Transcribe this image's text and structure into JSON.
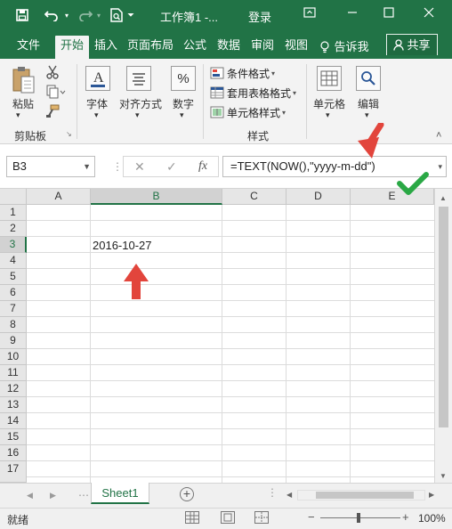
{
  "window": {
    "title": "工作簿1  -...",
    "login": "登录"
  },
  "tabs": [
    {
      "label": "文件"
    },
    {
      "label": "开始"
    },
    {
      "label": "插入"
    },
    {
      "label": "页面布局"
    },
    {
      "label": "公式"
    },
    {
      "label": "数据"
    },
    {
      "label": "审阅"
    },
    {
      "label": "视图"
    }
  ],
  "tell_me": "告诉我",
  "share": "共享",
  "ribbon": {
    "paste": "粘贴",
    "clipboard_group": "剪贴板",
    "font": "字体",
    "alignment": "对齐方式",
    "number": "数字",
    "conditional_formatting": "条件格式",
    "format_as_table": "套用表格格式",
    "cell_styles": "单元格样式",
    "styles_group": "样式",
    "cells": "单元格",
    "editing": "编辑"
  },
  "formula_bar": {
    "name_box": "B3",
    "cancel": "✕",
    "enter": "✓",
    "fx": "fx",
    "formula": "=TEXT(NOW(),\"yyyy-m-dd\")"
  },
  "grid": {
    "columns": [
      "A",
      "B",
      "C",
      "D",
      "E"
    ],
    "rows": [
      "1",
      "2",
      "3",
      "4",
      "5",
      "6",
      "7",
      "8",
      "9",
      "10",
      "11",
      "12",
      "13",
      "14",
      "15",
      "16",
      "17"
    ],
    "cell_B3": "2016-10-27"
  },
  "sheet": {
    "tab": "Sheet1",
    "add": "+"
  },
  "status": {
    "ready": "就绪",
    "zoom_minus": "−",
    "zoom_plus": "+",
    "zoom": "100%"
  },
  "colors": {
    "excel_green": "#217346",
    "arrow_red": "#e2453c",
    "check_green": "#2aa845"
  }
}
